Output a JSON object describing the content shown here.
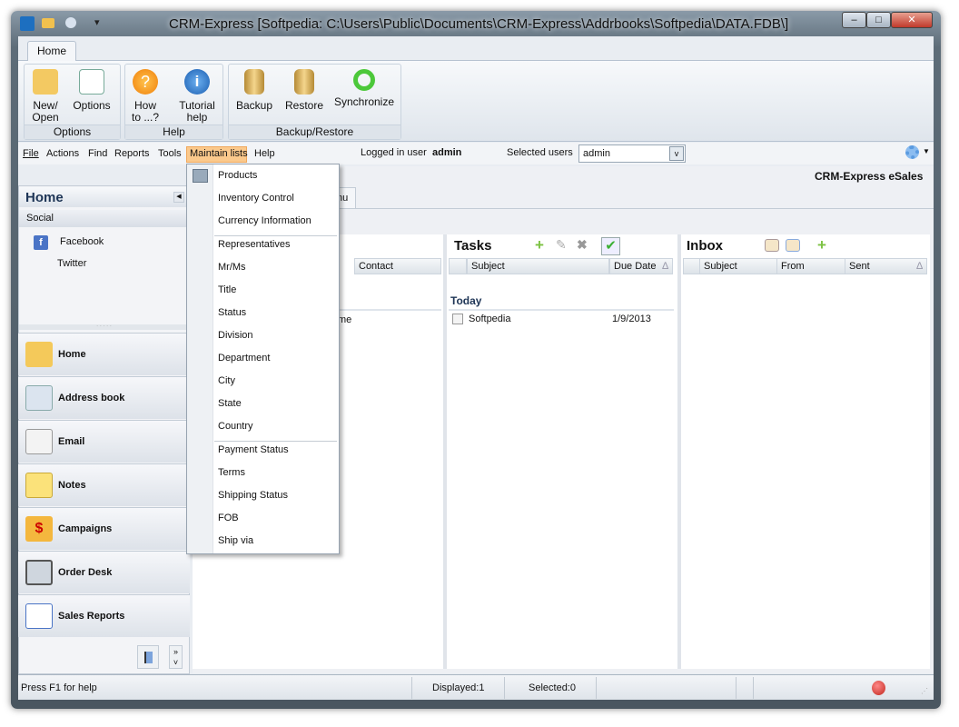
{
  "window": {
    "title": "CRM-Express [Softpedia: C:\\Users\\Public\\Documents\\CRM-Express\\Addrbooks\\Softpedia\\DATA.FDB\\]",
    "minimize": "–",
    "maximize": "□",
    "close": "✕"
  },
  "ribbon": {
    "tab": "Home",
    "groups": [
      {
        "label": "Options",
        "buttons": [
          {
            "l1": "New/",
            "l2": "Open"
          },
          {
            "l1": "Options",
            "l2": ""
          }
        ]
      },
      {
        "label": "Help",
        "buttons": [
          {
            "l1": "How",
            "l2": "to ...?"
          },
          {
            "l1": "Tutorial",
            "l2": "help"
          }
        ]
      },
      {
        "label": "Backup/Restore",
        "buttons": [
          {
            "l1": "Backup",
            "l2": ""
          },
          {
            "l1": "Restore",
            "l2": ""
          },
          {
            "l1": "Synchronize",
            "l2": ""
          }
        ]
      }
    ]
  },
  "menubar": {
    "items": [
      "File",
      "Actions",
      "Find",
      "Reports",
      "Tools",
      "Maintain lists",
      "Help"
    ],
    "logged_label": "Logged in user",
    "logged_user": "admin",
    "selected_label": "Selected users",
    "selected_value": "admin",
    "brand": "CRM-Express eSales"
  },
  "left": {
    "title": "Home",
    "section": "Social",
    "links": [
      "Facebook",
      "Twitter"
    ],
    "nav": [
      "Home",
      "Address book",
      "Email",
      "Notes",
      "Campaigns",
      "Order Desk",
      "Sales Reports"
    ]
  },
  "main": {
    "tab": "nu",
    "contacts": {
      "col": "Contact",
      "row": "me"
    },
    "tasks": {
      "title": "Tasks",
      "cols": [
        "Subject",
        "Due Date"
      ],
      "group": "Today",
      "rows": [
        {
          "subject": "Softpedia",
          "due": "1/9/2013"
        }
      ]
    },
    "inbox": {
      "title": "Inbox",
      "cols": [
        "Subject",
        "From",
        "Sent"
      ]
    }
  },
  "dropdown": {
    "groups": [
      [
        "Products",
        "Inventory Control",
        "Currency Information"
      ],
      [
        "Representatives",
        "Mr/Ms",
        "Title",
        "Status",
        "Division",
        "Department",
        "City",
        "State",
        "Country"
      ],
      [
        "Payment Status",
        "Terms",
        "Shipping Status",
        "FOB",
        "Ship via"
      ]
    ]
  },
  "status": {
    "help": "Press F1 for help",
    "displayed": "Displayed:1",
    "selected": "Selected:0"
  }
}
